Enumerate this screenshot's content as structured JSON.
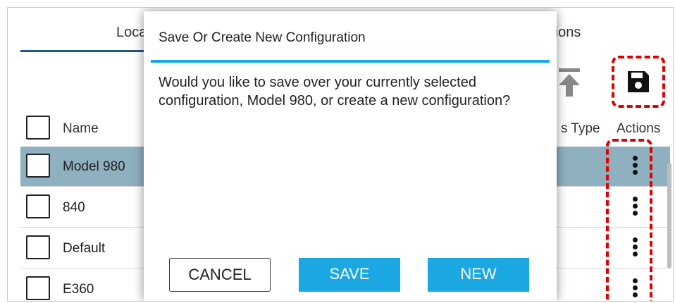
{
  "tabs": [
    {
      "label": "Loca"
    },
    {
      "label": "ations"
    }
  ],
  "table": {
    "headers": {
      "name": "Name",
      "type": "s Type",
      "actions": "Actions"
    },
    "rows": [
      {
        "name": "Model 980",
        "selected": true
      },
      {
        "name": "840",
        "selected": false
      },
      {
        "name": "Default",
        "selected": false
      },
      {
        "name": "E360",
        "selected": false
      }
    ]
  },
  "toolbar": {
    "upload_icon": "upload-icon",
    "save_icon": "floppy-disk-icon"
  },
  "dialog": {
    "title": "Save Or Create New Configuration",
    "message": "Would you like to save over your currently selected configuration, Model 980, or create a new configuration?",
    "buttons": {
      "cancel": "CANCEL",
      "save": "SAVE",
      "new": "NEW"
    }
  },
  "colors": {
    "accent": "#1aa7e2",
    "selected_row": "#8fb0bf",
    "highlight_dash": "#e10000",
    "tab_underline": "#1e5a86"
  }
}
